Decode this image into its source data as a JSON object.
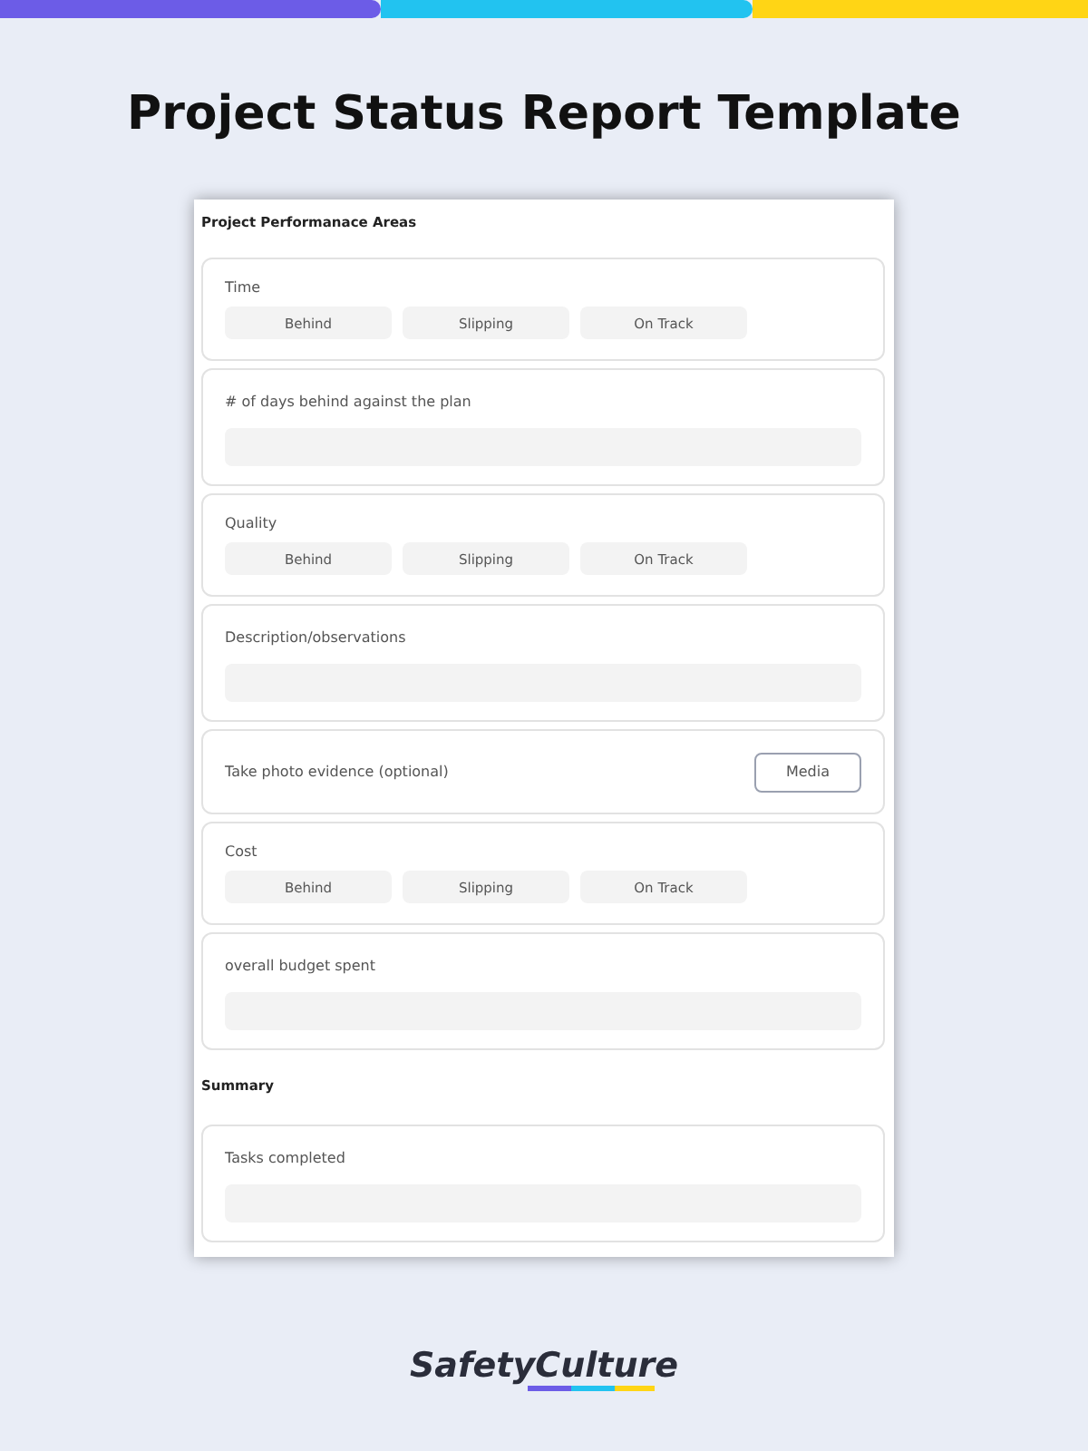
{
  "title": "Project Status Report Template",
  "sections": [
    {
      "heading": "Project Performanace Areas",
      "items": [
        {
          "kind": "options",
          "label": "Time",
          "options": [
            {
              "label": "Behind",
              "selected": false
            },
            {
              "label": "Slipping",
              "selected": false
            },
            {
              "label": "On Track",
              "selected": false
            }
          ]
        },
        {
          "kind": "input",
          "label": "# of days behind against the plan"
        },
        {
          "kind": "options",
          "label": "Quality",
          "options": [
            {
              "label": "Behind",
              "selected": false
            },
            {
              "label": "Slipping",
              "selected": false
            },
            {
              "label": "On Track",
              "selected": false
            }
          ]
        },
        {
          "kind": "input",
          "label": "Description/observations"
        },
        {
          "kind": "media",
          "label": "Take photo evidence (optional)",
          "button": "Media"
        },
        {
          "kind": "options",
          "label": "Cost",
          "options": [
            {
              "label": "Behind",
              "selected": false
            },
            {
              "label": "Slipping",
              "selected": false
            },
            {
              "label": "On Track",
              "selected": false
            }
          ]
        },
        {
          "kind": "input",
          "label": "overall budget spent"
        }
      ]
    },
    {
      "heading": "Summary",
      "items": [
        {
          "kind": "input",
          "label": "Tasks completed"
        }
      ]
    }
  ],
  "brand": "SafetyCulture"
}
